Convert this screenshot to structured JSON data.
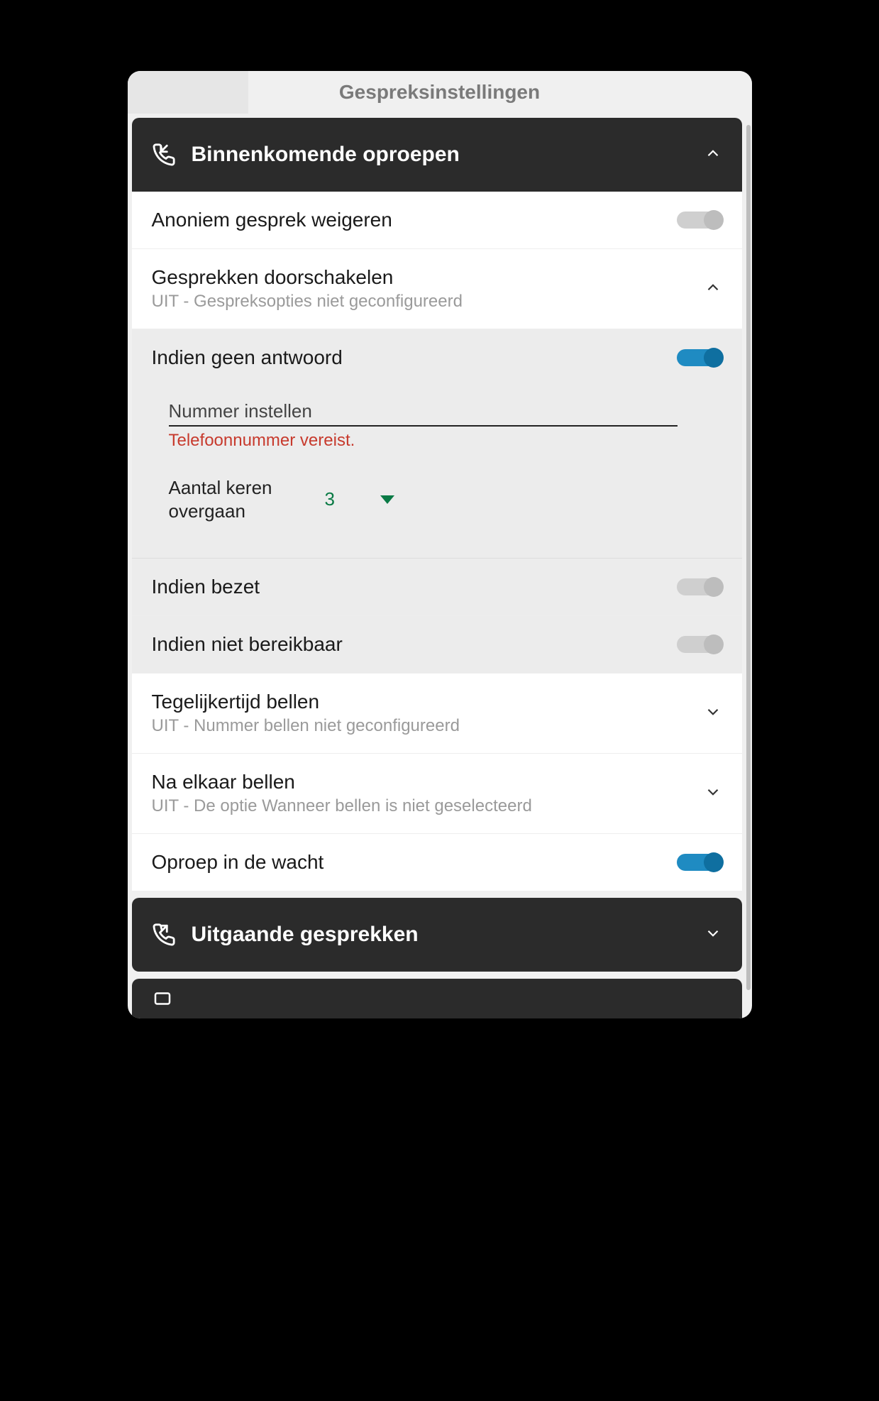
{
  "header": {
    "title": "Gespreksinstellingen"
  },
  "sections": {
    "incoming": {
      "label": "Binnenkomende oproepen"
    },
    "outgoing": {
      "label": "Uitgaande gesprekken"
    }
  },
  "rows": {
    "anon_reject": {
      "title": "Anoniem gesprek weigeren"
    },
    "forwarding": {
      "title": "Gesprekken doorschakelen",
      "sub": "UIT - Gespreksopties niet geconfigureerd"
    },
    "no_answer": {
      "title": "Indien geen antwoord",
      "number_placeholder": "Nummer instellen",
      "number_value": "",
      "error": "Telefoonnummer vereist.",
      "rings_label": "Aantal keren overgaan",
      "rings_value": "3"
    },
    "busy": {
      "title": "Indien bezet"
    },
    "unreachable": {
      "title": "Indien niet bereikbaar"
    },
    "sim_ring": {
      "title": "Tegelijkertijd bellen",
      "sub": "UIT - Nummer bellen niet geconfigureerd"
    },
    "seq_ring": {
      "title": "Na elkaar bellen",
      "sub": "UIT - De optie Wanneer bellen is niet geselecteerd"
    },
    "call_waiting": {
      "title": "Oproep in de wacht"
    }
  },
  "colors": {
    "accent": "#1f8bc2",
    "green": "#0a7a45",
    "error": "#c73a2d"
  }
}
